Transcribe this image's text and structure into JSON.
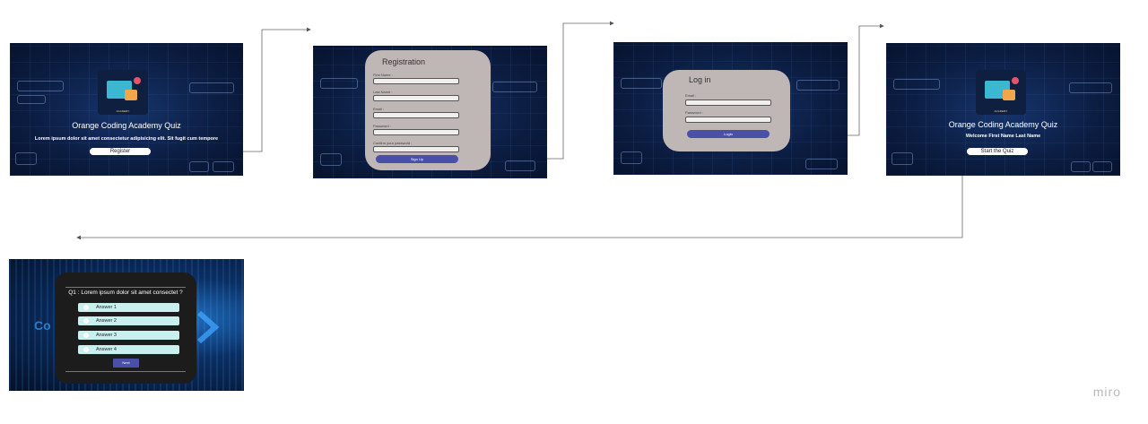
{
  "screen1": {
    "logo_label": "ACADEMY",
    "title": "Orange Coding Academy Quiz",
    "subtitle": "Lorem ipsum dolor sit amet consectetur adipisicing elit. Sit fugit cum tempore",
    "button": "Register"
  },
  "screen2": {
    "title": "Registration",
    "fields": [
      "First Name :",
      "Last Name :",
      "Email :",
      "Password :",
      "Confirm your password :"
    ],
    "button": "Sign Up"
  },
  "screen3": {
    "title": "Log in",
    "fields": [
      "Email :",
      "Password :"
    ],
    "button": "Login"
  },
  "screen4": {
    "logo_label": "ACADEMY",
    "title": "Orange Coding Academy Quiz",
    "welcome": "Welcome First Name Last Name",
    "button": "Start the Quiz"
  },
  "screen5": {
    "bg_text": "Co",
    "question": "Q1 : Lorem ipsum dolor sit amet consectet ?",
    "answers": [
      "Answer 1",
      "Answer 2",
      "Answer 3",
      "Answer 4"
    ],
    "button": "Next"
  },
  "watermark": "miro",
  "colors": {
    "card_gray": "#bfb6b6",
    "primary_button": "#4a4fa8",
    "answer_bg": "#c7f0ee",
    "frame_dark": "#0c1e44"
  }
}
